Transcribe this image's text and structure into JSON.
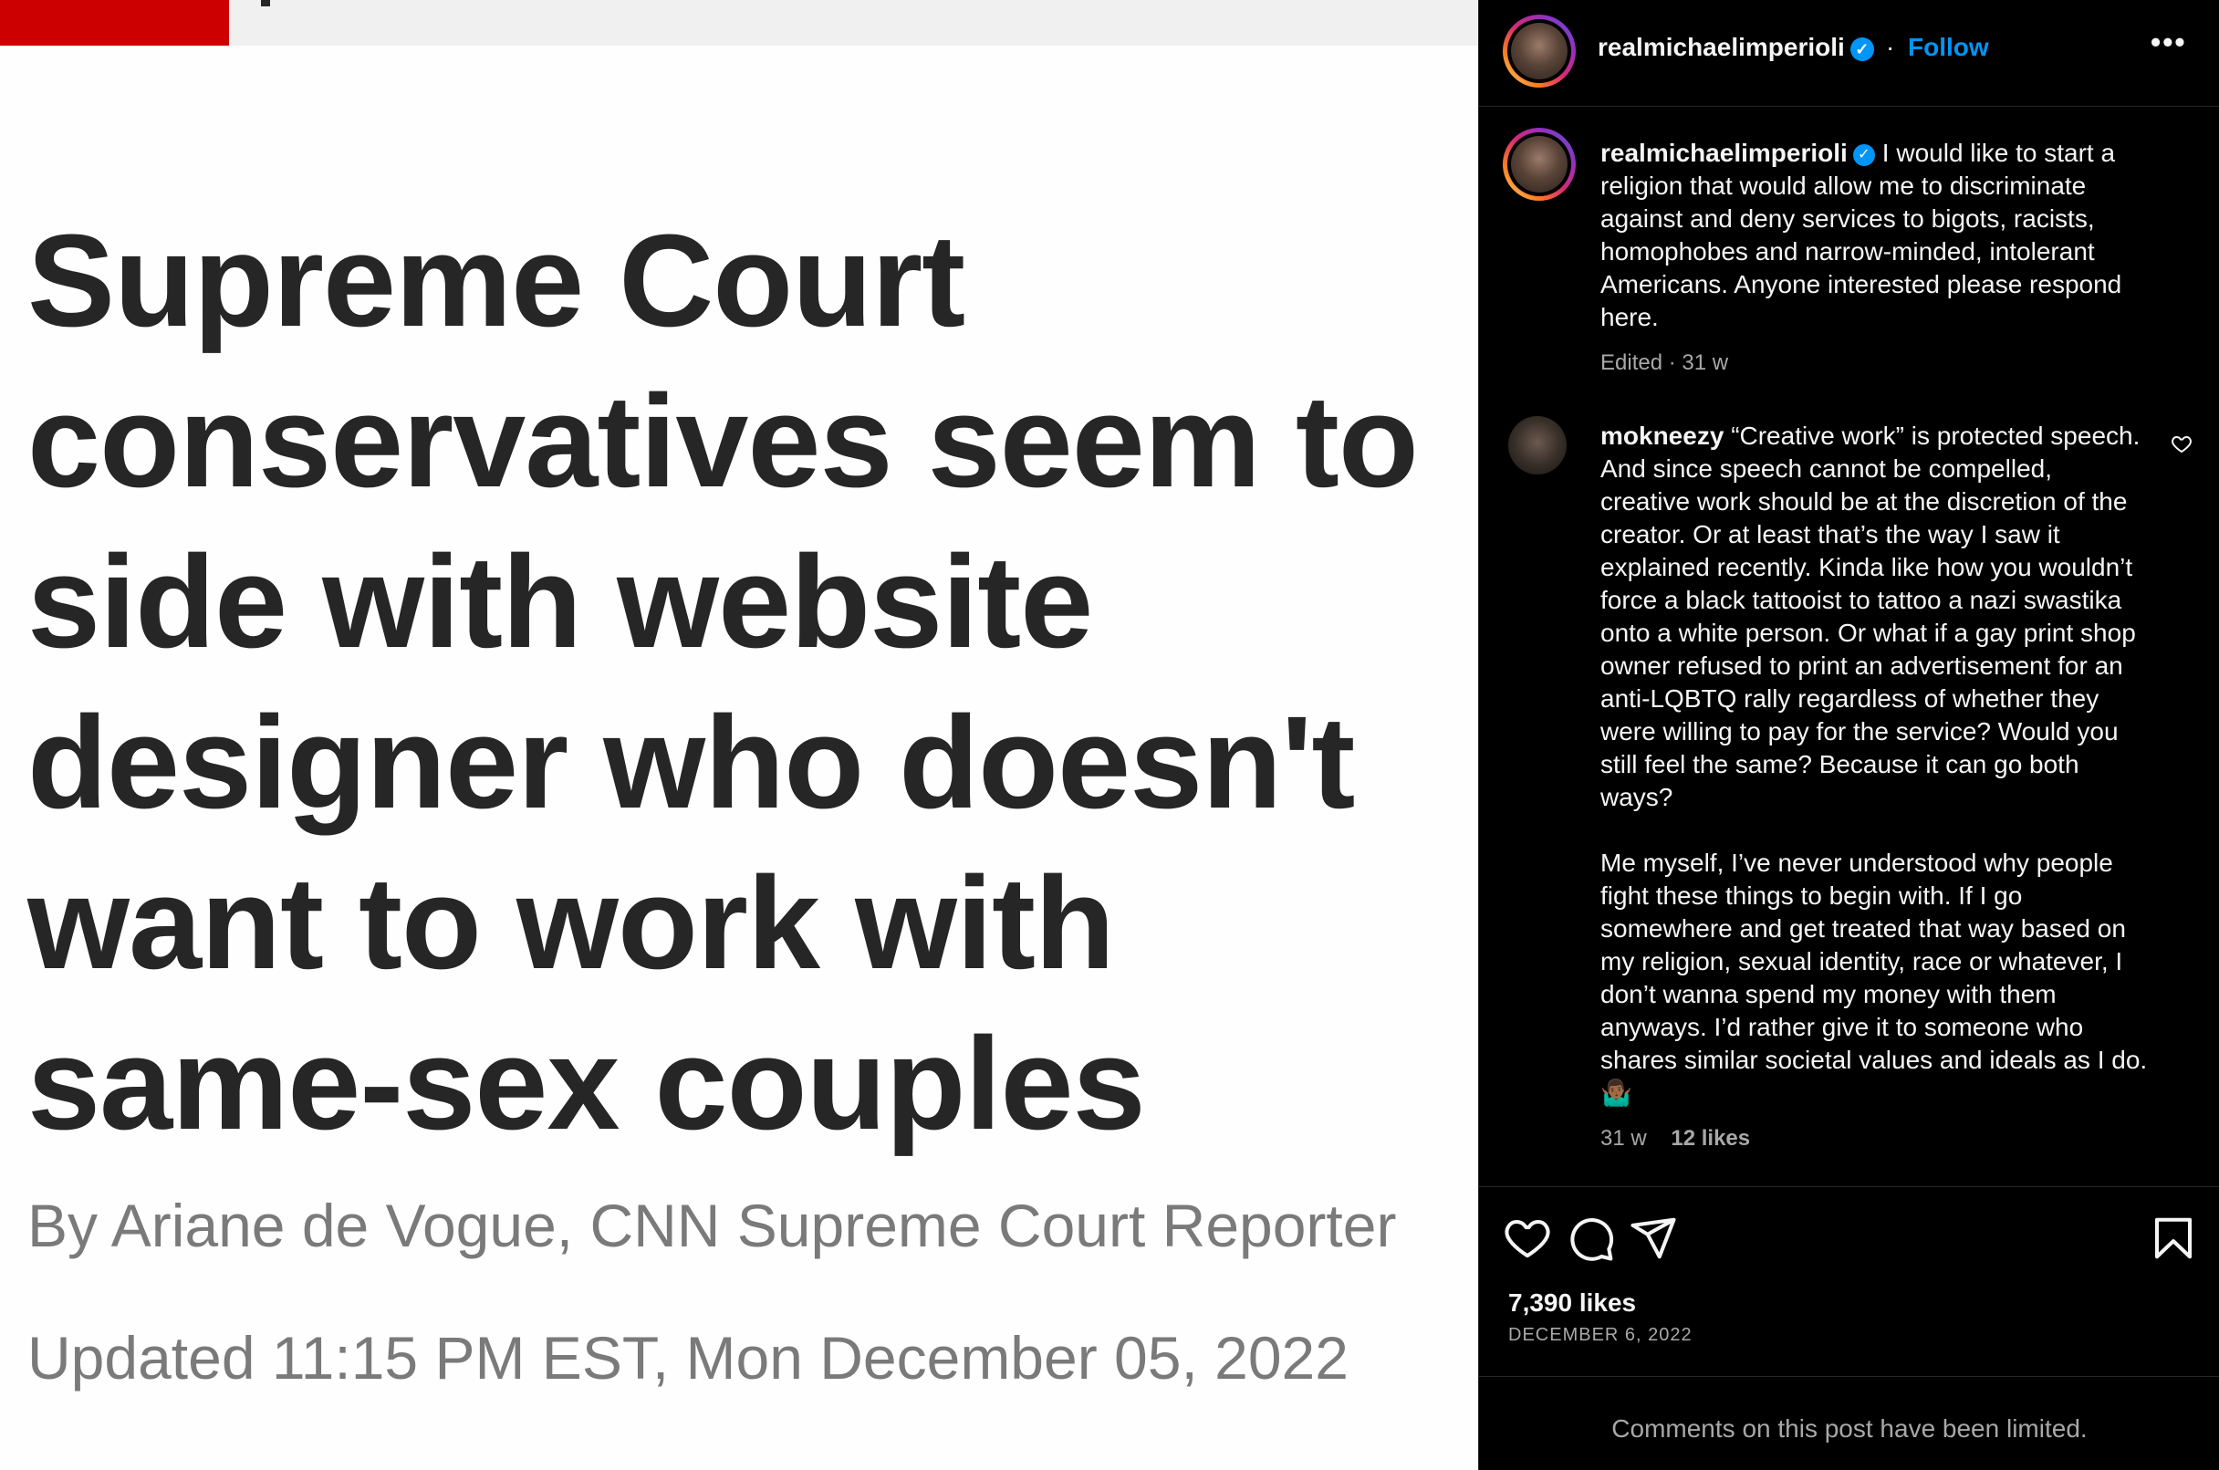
{
  "article": {
    "headline_lines": [
      "Supreme Court",
      "conservatives seem to",
      "side with website",
      "designer who doesn't",
      "want to work with",
      "same-sex couples"
    ],
    "byline": "By Ariane de Vogue, CNN Supreme Court Reporter",
    "updated": "Updated 11:15 PM EST, Mon December 05, 2022"
  },
  "post": {
    "header": {
      "username": "realmichaelimperioli",
      "separator": "·",
      "follow_label": "Follow",
      "more_label": "•••"
    },
    "caption": {
      "username": "realmichaelimperioli",
      "text": "I would like to start a religion that would allow me to discriminate against and deny services to bigots, racists, homophobes and narrow-minded, intolerant Americans. Anyone interested please respond here.",
      "meta": "Edited · 31 w"
    },
    "comment": {
      "username": "mokneezy",
      "text_p1": "“Creative work” is protected speech. And since speech cannot be compelled, creative work should be at the discretion of the creator. Or at least that’s the way I saw it explained recently. Kinda like how you wouldn’t force a black tattooist to tattoo a nazi swastika onto a white person. Or what if a gay print shop owner refused to print an advertisement for an anti-LQBTQ rally regardless of whether they were willing to pay for the service? Would you still feel the same? Because it can go both ways?",
      "text_p2": "Me myself, I’ve never understood why people fight these things to begin with. If I go somewhere and get treated that way based on my religion, sexual identity, race or whatever, I don’t wanna spend my money with them anyways. I’d rather give it to someone who shares similar societal values and ideals as I do. 🤷🏾‍♂️",
      "age": "31 w",
      "likes": "12 likes"
    },
    "likes": "7,390 likes",
    "date": "DECEMBER 6, 2022",
    "comments_limited": "Comments on this post have been limited."
  }
}
